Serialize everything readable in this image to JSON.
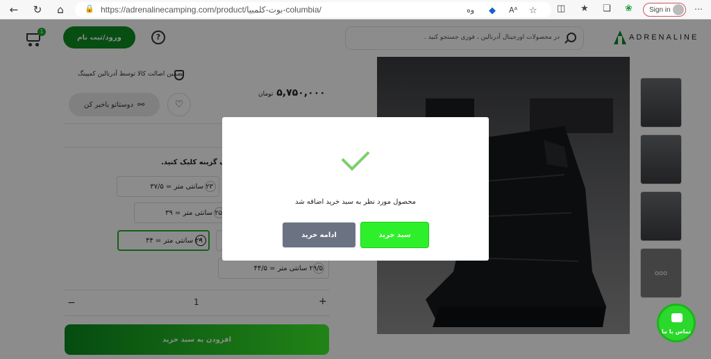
{
  "browser": {
    "url": "https://adrenalinecamping.com/product/بوت-کلمبیا-columbia/",
    "signin_label": "Sign in",
    "reader_label": "Aᴬ"
  },
  "header": {
    "logo_text": "ADRENALINE",
    "search_placeholder": "در محصولات اورجینال آدرنالین ، فوری جستجو کنید .",
    "login_label": "ورود/ثبت نام",
    "help_label": "?",
    "cart_count": "1"
  },
  "product": {
    "guarantee": "تضمین اصالت کالا توسط آدرنالین کمپینگ",
    "price": "۵,۷۵۰,۰۰۰",
    "currency": "تومان",
    "share_label": "دوستاتو باخبر کن",
    "choose_label": "یک گزینه کلیک کنید.",
    "sizes": [
      {
        "label": "۲۳ سانتی متر = ۳۷/۵"
      },
      {
        "label": "۲۵ سانتی متر = ۳۹"
      },
      {
        "label": "۲۹ سانتی متر = ۴۴"
      },
      {
        "label": "۲۹/۵ سانتی متر = ۴۴/۵"
      }
    ],
    "quantity": "1",
    "add_to_cart_label": "افزودن به سبد خرید",
    "more_thumbs_label": "ooo"
  },
  "modal": {
    "message": "محصول مورد نظر به سبد خرید اضافه شد",
    "cart_button": "سبد خرید",
    "continue_button": "ادامه خرید"
  },
  "chat": {
    "label": "تماس با ما"
  }
}
